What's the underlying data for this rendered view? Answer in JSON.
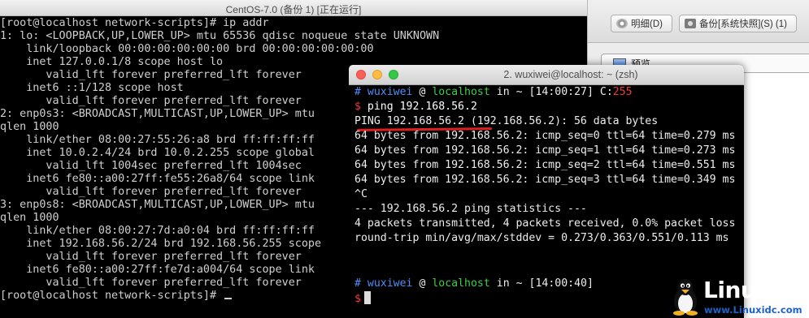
{
  "vm_window": {
    "title": "CentOS-7.0 (备份 1) [正在运行]",
    "console_lines": [
      "[root@localhost network-scripts]# ip addr",
      "1: lo: <LOOPBACK,UP,LOWER_UP> mtu 65536 qdisc noqueue state UNKNOWN",
      "    link/loopback 00:00:00:00:00:00 brd 00:00:00:00:00:00",
      "    inet 127.0.0.1/8 scope host lo",
      "       valid_lft forever preferred_lft forever",
      "    inet6 ::1/128 scope host",
      "       valid_lft forever preferred_lft forever",
      "2: enp0s3: <BROADCAST,MULTICAST,UP,LOWER_UP> mtu",
      "qlen 1000",
      "    link/ether 08:00:27:55:26:a8 brd ff:ff:ff:ff",
      "    inet 10.0.2.4/24 brd 10.0.2.255 scope global",
      "       valid_lft 1004sec preferred_lft 1004sec",
      "    inet6 fe80::a00:27ff:fe55:26a8/64 scope link",
      "       valid_lft forever preferred_lft forever",
      "3: enp0s8: <BROADCAST,MULTICAST,UP,LOWER_UP> mtu",
      "qlen 1000",
      "    link/ether 08:00:27:7d:a0:04 brd ff:ff:ff:ff",
      "    inet 192.168.56.2/24 brd 192.168.56.255 scope",
      "       valid_lft forever preferred_lft forever",
      "    inet6 fe80::a00:27ff:fe7d:a004/64 scope link",
      "       valid_lft forever preferred_lft forever",
      "[root@localhost network-scripts]# "
    ]
  },
  "vbox_manager": {
    "discard_label": "明细(D)",
    "snapshot_label": "备份[系统快照](S) (1)",
    "preview_tab_label": "预览",
    "discard_icon": "discard-icon",
    "snapshot_icon": "camera-icon",
    "preview_icon": "monitor-icon"
  },
  "terminal": {
    "title": "2. wuxiwei@localhost: ~ (zsh)",
    "prompt1": {
      "hash": "#",
      "user": "wuxiwei",
      "at": "@",
      "host": "localhost",
      "in": "in",
      "path": "~",
      "time": "[14:00:27]",
      "exit_label": "C:",
      "exit_code": "255"
    },
    "command_prompt": "$",
    "command": "ping 192.168.56.2",
    "output_lines": [
      "PING 192.168.56.2 (192.168.56.2): 56 data bytes",
      "64 bytes from 192.168.56.2: icmp_seq=0 ttl=64 time=0.279 ms",
      "64 bytes from 192.168.56.2: icmp_seq=1 ttl=64 time=0.273 ms",
      "64 bytes from 192.168.56.2: icmp_seq=2 ttl=64 time=0.551 ms",
      "64 bytes from 192.168.56.2: icmp_seq=3 ttl=64 time=0.349 ms",
      "^C",
      "--- 192.168.56.2 ping statistics ---",
      "4 packets transmitted, 4 packets received, 0.0% packet loss",
      "round-trip min/avg/max/stddev = 0.273/0.363/0.551/0.113 ms"
    ],
    "prompt2": {
      "hash": "#",
      "user": "wuxiwei",
      "at": "@",
      "host": "localhost",
      "in": "in",
      "path": "~",
      "time": "[14:00:40]"
    },
    "final_prompt": "$",
    "colors": {
      "hash": "#4f8ef7",
      "user": "#4f8ef7",
      "host": "#3fcf4a",
      "exit_code": "#f03c3c",
      "dollar": "#f03c3c"
    }
  },
  "watermark": {
    "brand": "Linux",
    "suffix": "公社",
    "url": "www.Linuxidc.com",
    "icon": "tux-penguin-icon"
  }
}
